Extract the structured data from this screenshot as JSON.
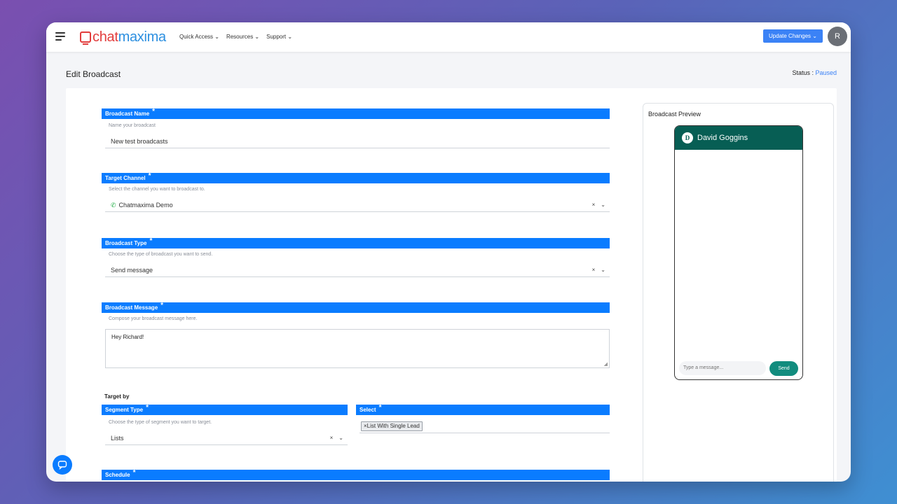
{
  "nav": {
    "logo_chat": "chat",
    "logo_maxima": "maxima",
    "items": [
      "Quick Access ⌄",
      "Resources ⌄",
      "Support ⌄"
    ],
    "update_button": "Update Changes ⌄",
    "avatar_initial": "R"
  },
  "page": {
    "title": "Edit Broadcast",
    "status_label": "Status : ",
    "status_value": "Paused"
  },
  "form": {
    "name": {
      "label": "Broadcast Name",
      "hint": "Name your broadcast",
      "value": "New test broadcasts"
    },
    "channel": {
      "label": "Target Channel",
      "hint": "Select the channel you want to broadcast to.",
      "value": "Chatmaxima Demo"
    },
    "type": {
      "label": "Broadcast Type",
      "hint": "Choose the type of broadcast you want to send.",
      "value": "Send message"
    },
    "message": {
      "label": "Broadcast Message",
      "hint": "Compose your broadcast message here.",
      "value": "Hey Richard!"
    },
    "target_by": "Target by",
    "segment": {
      "label": "Segment Type",
      "hint": "Choose the type of segment you want to target.",
      "value": "Lists"
    },
    "select": {
      "label": "Select",
      "chip": "List With Single Lead"
    },
    "schedule": {
      "label": "Schedule"
    },
    "required_star": "*",
    "clear_symbol": "×",
    "dropdown_symbol": "⌄"
  },
  "preview": {
    "title": "Broadcast Preview",
    "contact_initial": "D",
    "contact_name": "David Goggins",
    "input_placeholder": "Type a message...",
    "send_label": "Send"
  },
  "colors": {
    "accent": "#0a7cff",
    "whatsapp_header": "#075e54",
    "send_button": "#128c7e",
    "status": "#3b82f6"
  }
}
